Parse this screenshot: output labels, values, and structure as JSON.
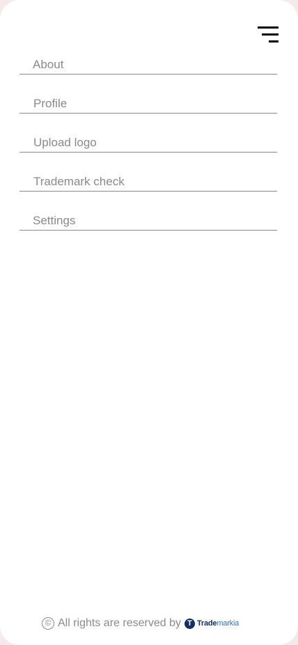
{
  "menu": {
    "items": [
      {
        "label": "About"
      },
      {
        "label": "Profile"
      },
      {
        "label": "Upload logo"
      },
      {
        "label": "Trademark check"
      },
      {
        "label": "Settings"
      }
    ]
  },
  "footer": {
    "copyright_symbol": "©",
    "text": "All rights are reserved by",
    "brand_mark": "T",
    "brand_name_primary": "Trade",
    "brand_name_accent": "markia"
  },
  "icons": {
    "menu": "menu-icon",
    "copyright": "copyright-icon",
    "brand": "trademarkia-logo-icon"
  },
  "colors": {
    "text_muted": "#8a8a8a",
    "brand_dark": "#0f2f6b",
    "brand_accent": "#2f6fd6"
  }
}
